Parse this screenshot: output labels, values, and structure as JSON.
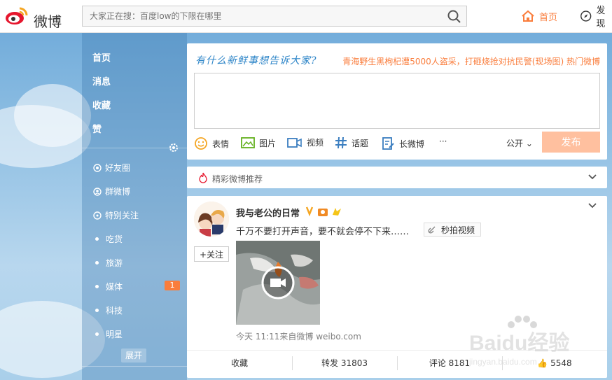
{
  "header": {
    "logo_text": "微博",
    "search_placeholder": "大家正在搜：百度low的下限在哪里",
    "nav": [
      {
        "label": "首页",
        "icon": "home-icon"
      },
      {
        "label": "发现",
        "icon": "compass-icon"
      }
    ]
  },
  "sidebar": {
    "main_items": [
      "首页",
      "消息",
      "收藏",
      "赞"
    ],
    "group_items": [
      {
        "label": "好友圈",
        "icon": "friends-circle-icon"
      },
      {
        "label": "群微博",
        "icon": "group-icon"
      },
      {
        "label": "特别关注",
        "icon": "special-follow-icon"
      },
      {
        "label": "吃货"
      },
      {
        "label": "旅游"
      },
      {
        "label": "媒体",
        "badge": "1"
      },
      {
        "label": "科技"
      },
      {
        "label": "明星"
      }
    ],
    "expand_label": "展开"
  },
  "compose": {
    "slogan": "有什么新鲜事想告诉大家?",
    "hot_topic": "青海野生黑枸杞遭5000人盗采，打砸烧抢对抗民警(现场图) 热门微博",
    "tools": [
      "表情",
      "图片",
      "视频",
      "话题",
      "长微博",
      "···"
    ],
    "visibility": "公开",
    "publish_label": "发布"
  },
  "recommend": {
    "label": "精彩微博推荐"
  },
  "post": {
    "author": "我与老公的日常",
    "text": "千万不要打开声音，要不就会停不下来……",
    "video_link_label": "秒拍视频",
    "follow_label": "+关注",
    "meta": "今天 11:11来自微博 weibo.com",
    "actions": [
      "收藏",
      "转发 31803",
      "评论 8181",
      "5548"
    ]
  },
  "watermark": {
    "text": "Baidu经验",
    "sub": "jingyan.baidu.com"
  },
  "colors": {
    "accent": "#fa7d3c",
    "link_blue": "#2d85c8",
    "publish_disabled": "#ffc09f"
  }
}
